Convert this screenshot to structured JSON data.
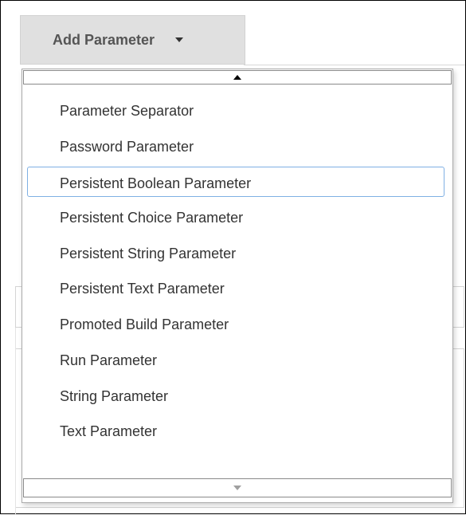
{
  "add_parameter": {
    "label": "Add Parameter"
  },
  "dropdown": {
    "focused_index": 2,
    "items": [
      "Parameter Separator",
      "Password Parameter",
      "Persistent Boolean Parameter",
      "Persistent Choice Parameter",
      "Persistent String Parameter",
      "Persistent Text Parameter",
      "Promoted Build Parameter",
      "Run Parameter",
      "String Parameter",
      "Text Parameter"
    ]
  },
  "colors": {
    "button_bg": "#e0e0e0",
    "text": "#333333",
    "focus_outline": "#7fb0e4"
  }
}
